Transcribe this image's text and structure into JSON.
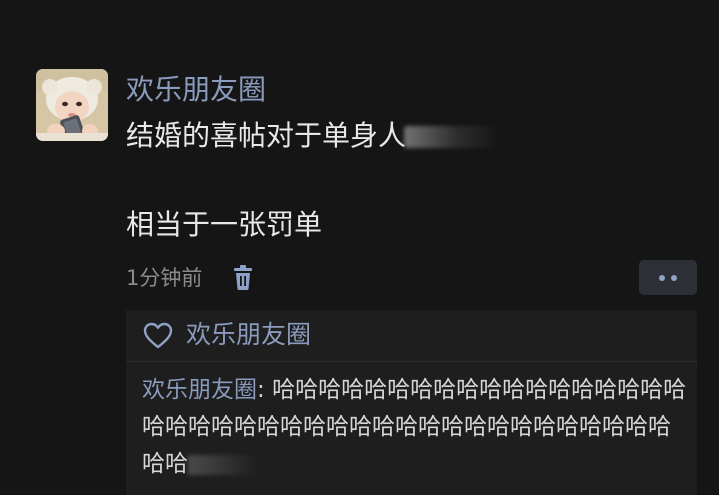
{
  "post": {
    "author": "欢乐朋友圈",
    "avatar_icon": "baby-with-phone-avatar",
    "text_line1": "结婚的喜帖对于单身人",
    "text_line2": "相当于一张罚单",
    "time": "1分钟前",
    "delete_icon": "trash-icon",
    "more_icon": "more-dots-icon"
  },
  "interactions": {
    "like_icon": "heart-icon",
    "likes": [
      "欢乐朋友圈"
    ],
    "comments": [
      {
        "author": "欢乐朋友圈",
        "separator": ": ",
        "text": "哈哈哈哈哈哈哈哈哈哈哈哈哈哈哈哈哈哈哈哈哈哈哈哈哈哈哈哈哈哈哈哈哈哈哈哈哈哈哈哈哈哈哈"
      }
    ]
  },
  "colors": {
    "background": "#151515",
    "name_blue": "#8a9bbd",
    "text": "#e8e8e8",
    "muted": "#8b8b8b",
    "panel": "#1e1e1e"
  }
}
